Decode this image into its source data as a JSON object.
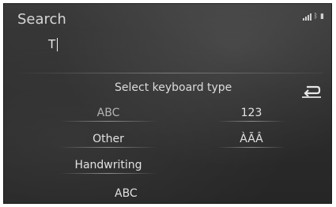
{
  "header": {
    "title": "Search"
  },
  "search": {
    "value": "T"
  },
  "keyboard_menu": {
    "heading": "Select keyboard type",
    "options": [
      {
        "label": "ABC"
      },
      {
        "label": "123"
      },
      {
        "label": "Other"
      },
      {
        "label": "ÀÃÂ"
      },
      {
        "label": "Handwriting"
      }
    ],
    "current_label": "ABC"
  },
  "icons": {
    "status": [
      "signal-icon",
      "bluetooth-icon",
      "battery-icon"
    ],
    "back": "back-icon"
  }
}
